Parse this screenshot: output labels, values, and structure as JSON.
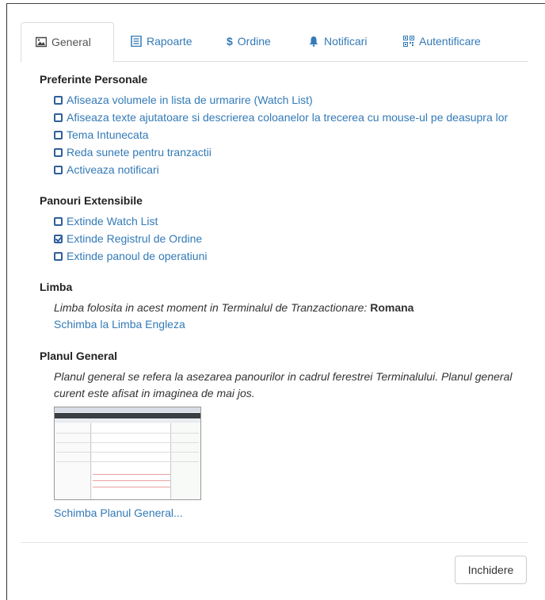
{
  "tabs": [
    {
      "label": "General",
      "icon": "image-icon",
      "active": true
    },
    {
      "label": "Rapoarte",
      "icon": "report-icon"
    },
    {
      "label": "Ordine",
      "icon": "dollar-icon"
    },
    {
      "label": "Notificari",
      "icon": "bell-icon"
    },
    {
      "label": "Autentificare",
      "icon": "qrcode-icon"
    }
  ],
  "personal": {
    "title": "Preferinte Personale",
    "options": [
      {
        "label": "Afiseaza volumele in lista de urmarire (Watch List)",
        "checked": false
      },
      {
        "label": "Afiseaza texte ajutatoare si descrierea coloanelor la trecerea cu mouse-ul pe deasupra lor",
        "checked": false
      },
      {
        "label": "Tema Intunecata",
        "checked": false
      },
      {
        "label": "Reda sunete pentru tranzactii",
        "checked": false
      },
      {
        "label": "Activeaza notificari",
        "checked": false
      }
    ]
  },
  "panels": {
    "title": "Panouri Extensibile",
    "options": [
      {
        "label": "Extinde Watch List",
        "checked": false
      },
      {
        "label": "Extinde Registrul de Ordine",
        "checked": true
      },
      {
        "label": "Extinde panoul de operatiuni",
        "checked": false
      }
    ]
  },
  "language": {
    "title": "Limba",
    "text": "Limba folosita in acest moment in Terminalul de Tranzactionare: ",
    "current": "Romana",
    "link": "Schimba la Limba Engleza"
  },
  "layout": {
    "title": "Planul General",
    "text": "Planul general se refera la asezarea panourilor in cadrul ferestrei Terminalului. Planul general curent este afisat in imaginea de mai jos.",
    "link": "Schimba Planul General..."
  },
  "footer": {
    "close_label": "Inchidere"
  },
  "colors": {
    "link": "#337ab7",
    "checkbox": "#2f5f9a",
    "border": "#dddddd"
  }
}
